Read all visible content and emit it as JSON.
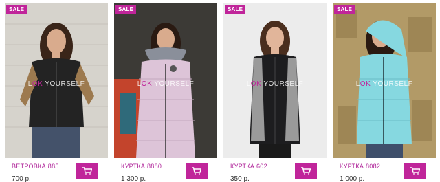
{
  "products": [
    {
      "badge": "SALE",
      "watermark_pre": "L",
      "watermark_accent": "OK",
      "watermark_post": " YOURSELF",
      "title": "Ветровка 885",
      "price": "700 р.",
      "cart_icon": "cart-icon",
      "colors": {
        "bg": "#d6d3cc",
        "jacket": "#232323",
        "sleeve": "#9d7a4f",
        "skin": "#d9ab8d",
        "hair": "#3a2519",
        "pants": "#44526a"
      }
    },
    {
      "badge": "SALE",
      "watermark_pre": "L",
      "watermark_accent": "OK",
      "watermark_post": " YOURSELF",
      "title": "Куртка 8880",
      "price": "1 300 р.",
      "cart_icon": "cart-icon",
      "colors": {
        "bg": "#3c3a36",
        "jacket": "#ddc4d8",
        "sleeve": "#ddc4d8",
        "skin": "#d9ab8d",
        "hair": "#2a1a12",
        "pants": "#2b2b2b"
      }
    },
    {
      "badge": "SALE",
      "watermark_pre": "L",
      "watermark_accent": "OK",
      "watermark_post": " YOURSELF",
      "title": "Куртка 602",
      "price": "350 р.",
      "cart_icon": "cart-icon",
      "colors": {
        "bg": "#ececec",
        "jacket": "#1d1d1f",
        "sleeve": "#9a9a9a",
        "skin": "#e1b59a",
        "hair": "#4a2e1e",
        "pants": "#1a1a1a"
      }
    },
    {
      "badge": "SALE",
      "watermark_pre": "L",
      "watermark_accent": "OK",
      "watermark_post": " YOURSELF",
      "title": "Куртка 8082",
      "price": "1 000 р.",
      "cart_icon": "cart-icon",
      "colors": {
        "bg": "#b29a67",
        "jacket": "#86d8e0",
        "sleeve": "#86d8e0",
        "skin": "#d9ab8d",
        "hair": "#2a1a12",
        "pants": "#3f4f6b"
      }
    }
  ]
}
